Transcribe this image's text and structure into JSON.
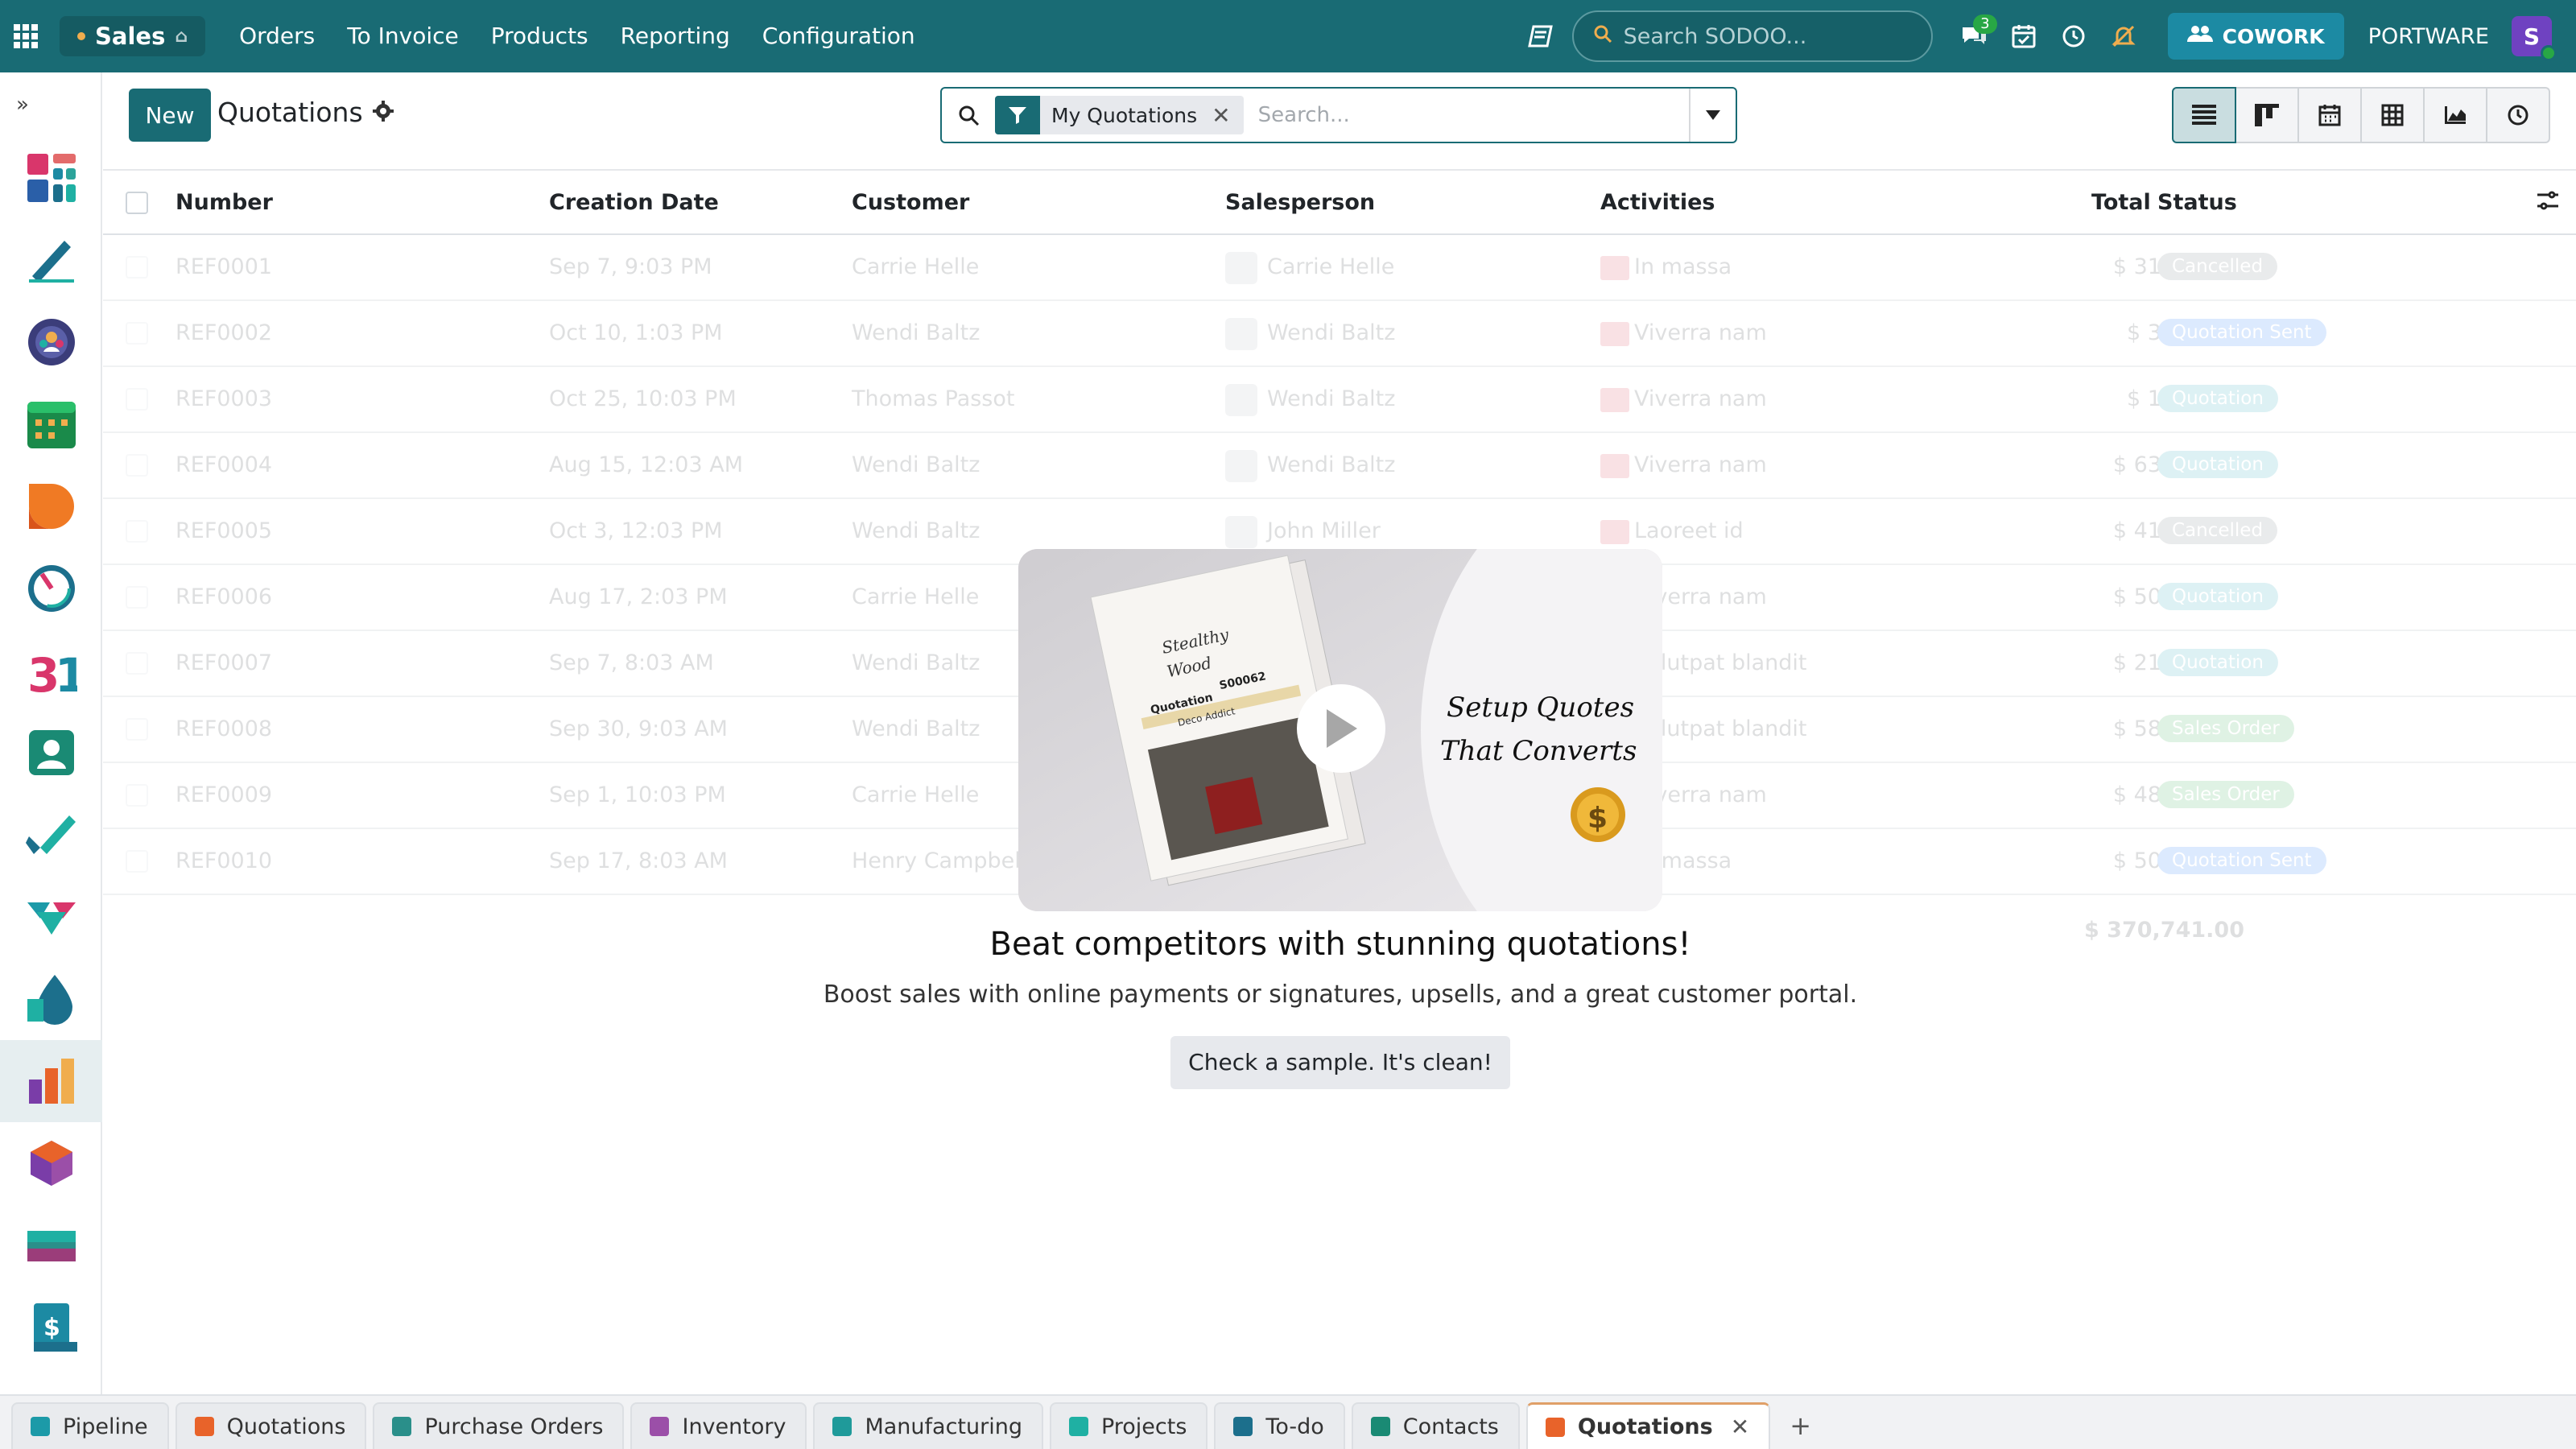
{
  "topbar": {
    "app_name": "Sales",
    "menu": [
      "Orders",
      "To Invoice",
      "Products",
      "Reporting",
      "Configuration"
    ],
    "search_placeholder": "Search SODOO...",
    "messages_badge": "3",
    "cowork_label": "COWORK",
    "company": "PORTWARE",
    "avatar_letter": "S"
  },
  "control": {
    "new_label": "New",
    "title": "Quotations",
    "facet_label": "My Quotations",
    "search_placeholder": "Search..."
  },
  "list": {
    "headers": {
      "number": "Number",
      "creation_date": "Creation Date",
      "customer": "Customer",
      "salesperson": "Salesperson",
      "activities": "Activities",
      "total": "Total",
      "status": "Status"
    },
    "rows": [
      {
        "number": "REF0001",
        "date": "Sep 7, 9:03 PM",
        "customer": "Carrie Helle",
        "salesperson": "Carrie Helle",
        "activity": "In massa",
        "total": "$ 31,885.00",
        "status": "Cancelled",
        "status_kind": "cancel"
      },
      {
        "number": "REF0002",
        "date": "Oct 10, 1:03 PM",
        "customer": "Wendi Baltz",
        "salesperson": "Wendi Baltz",
        "activity": "Viverra nam",
        "total": "$ 3,295.00",
        "status": "Quotation Sent",
        "status_kind": "sent"
      },
      {
        "number": "REF0003",
        "date": "Oct 25, 10:03 PM",
        "customer": "Thomas Passot",
        "salesperson": "Wendi Baltz",
        "activity": "Viverra nam",
        "total": "$ 1,986.00",
        "status": "Quotation",
        "status_kind": "quote"
      },
      {
        "number": "REF0004",
        "date": "Aug 15, 12:03 AM",
        "customer": "Wendi Baltz",
        "salesperson": "Wendi Baltz",
        "activity": "Viverra nam",
        "total": "$ 63,247.00",
        "status": "Quotation",
        "status_kind": "quote"
      },
      {
        "number": "REF0005",
        "date": "Oct 3, 12:03 PM",
        "customer": "Wendi Baltz",
        "salesperson": "John Miller",
        "activity": "Laoreet id",
        "total": "$ 41,375.00",
        "status": "Cancelled",
        "status_kind": "cancel"
      },
      {
        "number": "REF0006",
        "date": "Aug 17, 2:03 PM",
        "customer": "Carrie Helle",
        "salesperson": "",
        "activity": "Viverra nam",
        "total": "$ 50,228.00",
        "status": "Quotation",
        "status_kind": "quote"
      },
      {
        "number": "REF0007",
        "date": "Sep 7, 8:03 AM",
        "customer": "Wendi Baltz",
        "salesperson": "",
        "activity": "Volutpat blandit",
        "total": "$ 21,961.00",
        "status": "Quotation",
        "status_kind": "quote"
      },
      {
        "number": "REF0008",
        "date": "Sep 30, 9:03 AM",
        "customer": "Wendi Baltz",
        "salesperson": "",
        "activity": "Volutpat blandit",
        "total": "$ 58,595.00",
        "status": "Sales Order",
        "status_kind": "order"
      },
      {
        "number": "REF0009",
        "date": "Sep 1, 10:03 PM",
        "customer": "Carrie Helle",
        "salesperson": "",
        "activity": "Viverra nam",
        "total": "$ 48,048.00",
        "status": "Sales Order",
        "status_kind": "order"
      },
      {
        "number": "REF0010",
        "date": "Sep 17, 8:03 AM",
        "customer": "Henry Campbell",
        "salesperson": "",
        "activity": "In massa",
        "total": "$ 50,121.00",
        "status": "Quotation Sent",
        "status_kind": "sent"
      }
    ],
    "grand_total": "$ 370,741.00"
  },
  "helper": {
    "video_brand_line1": "Stealthy",
    "video_brand_line2": "Wood",
    "video_doc_title": "Quotation",
    "video_doc_number": "S00062",
    "video_doc_customer": "Deco Addict",
    "video_caption_line1": "Setup Quotes",
    "video_caption_line2": "That Converts",
    "title": "Beat competitors with stunning quotations!",
    "subtitle": "Boost sales with online payments or signatures, upsells, and a great customer portal.",
    "sample_button": "Check a sample. It's clean!"
  },
  "tabs": [
    {
      "label": "Pipeline",
      "color": "#1c9aa8"
    },
    {
      "label": "Quotations",
      "color": "#e8632a"
    },
    {
      "label": "Purchase Orders",
      "color": "#2a8f8a"
    },
    {
      "label": "Inventory",
      "color": "#9b4fa8"
    },
    {
      "label": "Manufacturing",
      "color": "#1f9a9a"
    },
    {
      "label": "Projects",
      "color": "#1fb0a3"
    },
    {
      "label": "To-do",
      "color": "#1c6f8c"
    },
    {
      "label": "Contacts",
      "color": "#1a8a74"
    },
    {
      "label": "Quotations",
      "color": "#e8632a",
      "active": true
    }
  ]
}
